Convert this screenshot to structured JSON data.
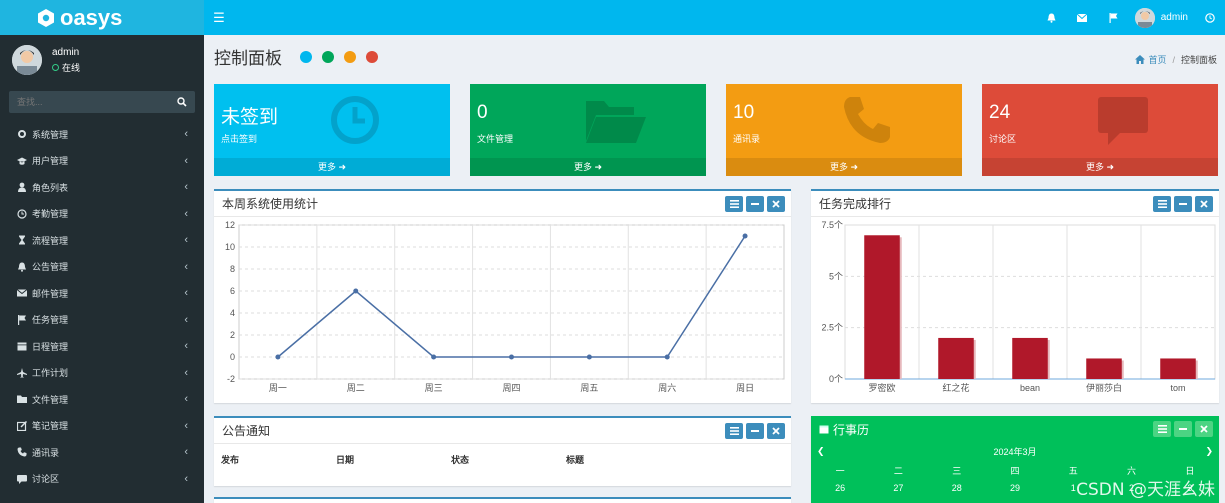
{
  "brand": {
    "name": "oasys"
  },
  "topbar": {
    "username": "admin"
  },
  "sidebar": {
    "username": "admin",
    "status": "在线",
    "search_placeholder": "查找...",
    "items": [
      {
        "label": "系统管理",
        "icon": "gear-icon"
      },
      {
        "label": "用户管理",
        "icon": "graduation-cap-icon"
      },
      {
        "label": "角色列表",
        "icon": "user-icon"
      },
      {
        "label": "考勤管理",
        "icon": "clock-icon"
      },
      {
        "label": "流程管理",
        "icon": "hourglass-icon"
      },
      {
        "label": "公告管理",
        "icon": "bell-icon"
      },
      {
        "label": "邮件管理",
        "icon": "envelope-icon"
      },
      {
        "label": "任务管理",
        "icon": "flag-icon"
      },
      {
        "label": "日程管理",
        "icon": "calendar-icon"
      },
      {
        "label": "工作计划",
        "icon": "plane-icon"
      },
      {
        "label": "文件管理",
        "icon": "folder-icon"
      },
      {
        "label": "笔记管理",
        "icon": "edit-icon"
      },
      {
        "label": "通讯录",
        "icon": "phone-icon"
      },
      {
        "label": "讨论区",
        "icon": "comment-icon"
      }
    ]
  },
  "header": {
    "title": "控制面板",
    "dots": [
      "#00b7ee",
      "#00a65a",
      "#f39c12",
      "#dd4b39"
    ],
    "breadcrumb_home": "首页",
    "breadcrumb_current": "控制面板"
  },
  "stats": [
    {
      "value": "未签到",
      "label": "点击签到",
      "more": "更多",
      "color": "#00c0ef",
      "icon": "clock-icon"
    },
    {
      "value": "0",
      "label": "文件管理",
      "more": "更多",
      "color": "#00a65a",
      "icon": "folder-open-icon"
    },
    {
      "value": "10",
      "label": "通讯录",
      "more": "更多",
      "color": "#f39c12",
      "icon": "phone-icon"
    },
    {
      "value": "24",
      "label": "讨论区",
      "more": "更多",
      "color": "#dd4b39",
      "icon": "comment-icon"
    }
  ],
  "panels": {
    "usage_title": "本周系统使用统计",
    "rank_title": "任务完成排行",
    "notice_title": "公告通知",
    "calendar_title": "行事历"
  },
  "notice_columns": [
    "发布",
    "日期",
    "状态",
    "标题"
  ],
  "calendar": {
    "month": "2024年3月",
    "weekdays": [
      "一",
      "二",
      "三",
      "四",
      "五",
      "六",
      "日"
    ],
    "first_row": [
      "26",
      "27",
      "28",
      "29",
      "1",
      "2",
      "3"
    ]
  },
  "watermark": "CSDN @天涯幺妹",
  "chart_data": [
    {
      "type": "line",
      "title": "本周系统使用统计",
      "categories": [
        "周一",
        "周二",
        "周三",
        "周四",
        "周五",
        "周六",
        "周日"
      ],
      "values": [
        0,
        6,
        0,
        0,
        0,
        0,
        11
      ],
      "ylim": [
        -2,
        12
      ],
      "yticks": [
        -2,
        0,
        2,
        4,
        6,
        8,
        10,
        12
      ],
      "grid": true,
      "color": "#4a6fa5"
    },
    {
      "type": "bar",
      "title": "任务完成排行",
      "categories": [
        "罗密欧",
        "红之花",
        "bean",
        "伊丽莎白",
        "tom"
      ],
      "values": [
        7,
        2,
        2,
        1,
        1
      ],
      "ylim": [
        0,
        7.5
      ],
      "ytick_labels": [
        "0个",
        "2.5个",
        "5个",
        "7.5个"
      ],
      "yticks": [
        0,
        2.5,
        5,
        7.5
      ],
      "grid": true,
      "color": "#b0182a"
    }
  ]
}
